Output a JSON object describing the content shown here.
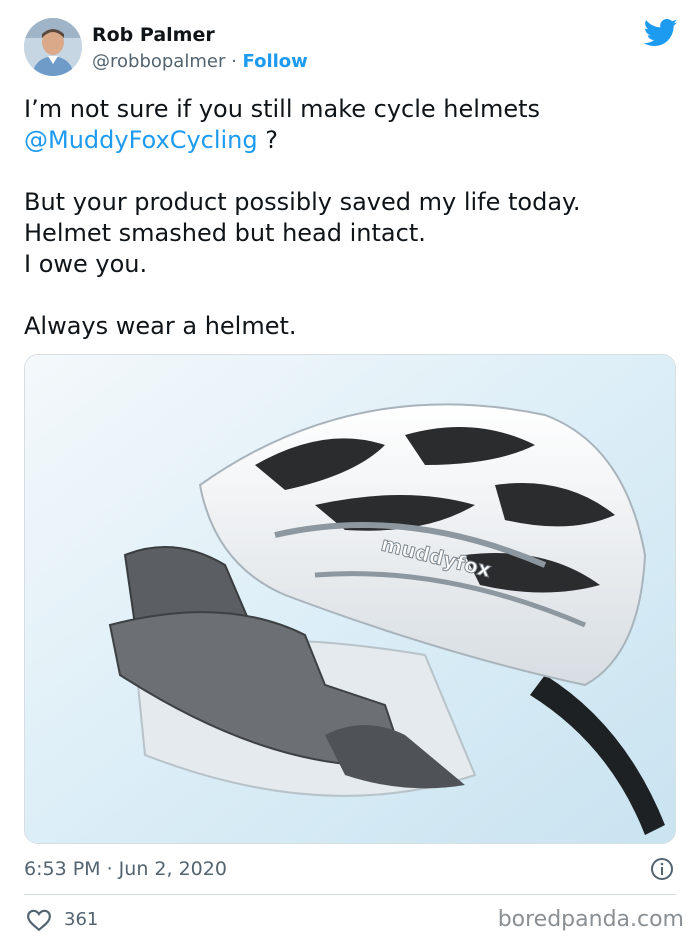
{
  "author": {
    "name": "Rob Palmer",
    "handle": "@robbopalmer",
    "separator": " · ",
    "follow_label": "Follow"
  },
  "tweet": {
    "line1": "I’m not sure if you still make cycle helmets",
    "mention": "@MuddyFoxCycling",
    "mention_suffix": " ?",
    "line3": "But your product possibly saved my life today.",
    "line4": "Helmet smashed but head intact.",
    "line5": "I owe you.",
    "line7": "Always wear a helmet."
  },
  "media": {
    "helmet_brand": "muddyfox"
  },
  "footer": {
    "timestamp": "6:53 PM · Jun 2, 2020",
    "like_count": "361"
  },
  "watermark": "boredpanda.com",
  "colors": {
    "accent": "#1d9bf0",
    "secondary_text": "#536471",
    "primary_text": "#0f1419"
  },
  "icons": {
    "brand": "twitter-bird-icon",
    "info": "info-icon",
    "like": "heart-icon"
  }
}
